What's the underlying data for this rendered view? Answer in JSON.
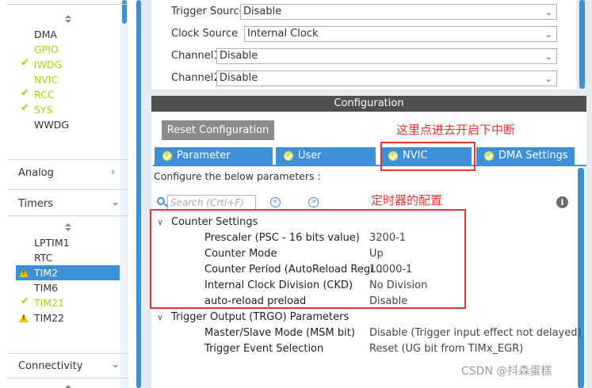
{
  "sidebar": {
    "peripherals": [
      {
        "label": "DMA",
        "status": "none"
      },
      {
        "label": "GPIO",
        "status": "configured"
      },
      {
        "label": "IWDG",
        "status": "ok"
      },
      {
        "label": "NVIC",
        "status": "configured"
      },
      {
        "label": "RCC",
        "status": "ok"
      },
      {
        "label": "SYS",
        "status": "ok"
      },
      {
        "label": "WWDG",
        "status": "none"
      }
    ],
    "categories": {
      "analog": "Analog",
      "timers": "Timers",
      "connectivity": "Connectivity"
    },
    "timers": [
      {
        "label": "LPTIM1",
        "status": "none"
      },
      {
        "label": "RTC",
        "status": "none"
      },
      {
        "label": "TIM2",
        "status": "warning",
        "selected": true
      },
      {
        "label": "TIM6",
        "status": "none"
      },
      {
        "label": "TIM21",
        "status": "ok"
      },
      {
        "label": "TIM22",
        "status": "warning"
      }
    ]
  },
  "mode": {
    "rows": [
      {
        "label": "Trigger Source",
        "value": "Disable"
      },
      {
        "label": "Clock Source",
        "value": "Internal Clock"
      },
      {
        "label": "Channel1",
        "value": "Disable"
      },
      {
        "label": "Channel2",
        "value": "Disable"
      }
    ]
  },
  "config": {
    "header": "Configuration",
    "reset_label": "Reset Configuration",
    "tabs": [
      "Parameter Settings",
      "User Constants",
      "NVIC Settings",
      "DMA Settings"
    ],
    "description": "Configure the below parameters :",
    "search_placeholder": "Search (Crtl+F)",
    "info_glyph": "i",
    "groups": [
      {
        "title": "Counter Settings",
        "params": [
          {
            "name": "Prescaler (PSC - 16 bits value)",
            "value": "3200-1"
          },
          {
            "name": "Counter Mode",
            "value": "Up"
          },
          {
            "name": "Counter Period (AutoReload Regi...",
            "value": "10000-1"
          },
          {
            "name": "Internal Clock Division (CKD)",
            "value": "No Division"
          },
          {
            "name": "auto-reload preload",
            "value": "Disable"
          }
        ]
      },
      {
        "title": "Trigger Output (TRGO) Parameters",
        "params": [
          {
            "name": "Master/Slave Mode (MSM bit)",
            "value": "Disable (Trigger input effect not delayed)"
          },
          {
            "name": "Trigger Event Selection",
            "value": "Reset (UG bit from TIMx_EGR)"
          }
        ]
      }
    ]
  },
  "annotations": {
    "nvic_note": "这里点进去开启下中断",
    "timer_note": "定时器的配置"
  },
  "watermark": "CSDN @抖森蛋糕",
  "colors": {
    "accent": "#3d8fd6",
    "ok": "#b7c912",
    "warning": "#f3c400",
    "annotation": "#e53434"
  }
}
